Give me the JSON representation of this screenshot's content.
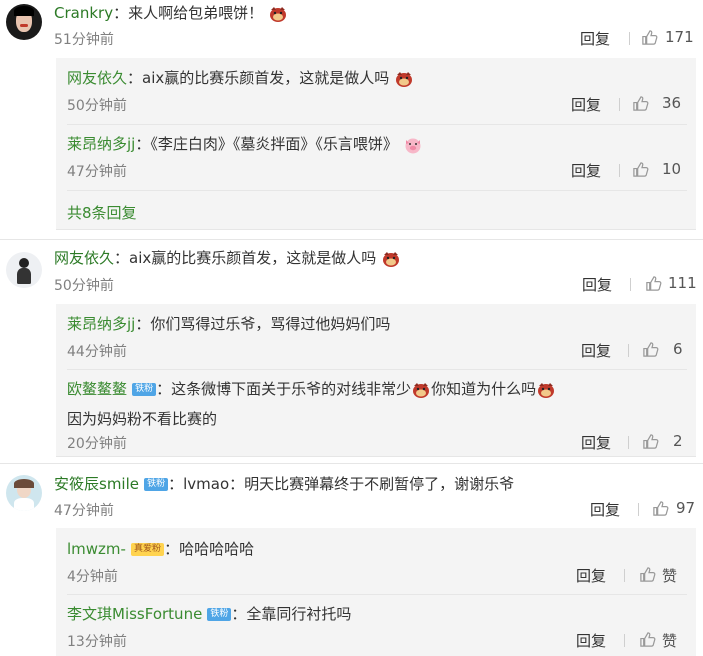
{
  "thumb_color": "#999999",
  "comments": [
    {
      "user": "Crankry",
      "text": "：来人啊给包弟喂饼！",
      "time": "51分钟前",
      "reply": "回复",
      "likes": "171",
      "subs": [
        {
          "user": "网友依久",
          "text": "：aix赢的比赛乐颜首发，这就是做人吗",
          "time": "50分钟前",
          "reply": "回复",
          "likes": "36"
        },
        {
          "user": "莱昂纳多jj",
          "text": "：《李庄白肉》《墓炎拌面》《乐言喂饼》",
          "time": "47分钟前",
          "reply": "回复",
          "likes": "10"
        }
      ],
      "more": "共8条回复"
    },
    {
      "user": "网友依久",
      "text": "：aix赢的比赛乐颜首发，这就是做人吗",
      "time": "50分钟前",
      "reply": "回复",
      "likes": "111",
      "subs": [
        {
          "user": "莱昂纳多jj",
          "text": "：你们骂得过乐爷，骂得过他妈妈们吗",
          "time": "44分钟前",
          "reply": "回复",
          "likes": "6"
        },
        {
          "user": "欧鳌鳌鳌",
          "badge": "铁粉",
          "text": "：这条微博下面关于乐爷的对线非常少",
          "text_b": "你知道为什么吗",
          "text2": "因为妈妈粉不看比赛的",
          "time": "20分钟前",
          "reply": "回复",
          "likes": "2"
        }
      ]
    },
    {
      "user": "安筱辰smile",
      "badge": "铁粉",
      "text": "：lvmao：明天比赛弹幕终于不刷暂停了，谢谢乐爷",
      "time": "47分钟前",
      "reply": "回复",
      "likes": "97",
      "subs": [
        {
          "user": "lmwzm-",
          "badge": "真爱粉",
          "text": "：哈哈哈哈哈",
          "time": "4分钟前",
          "reply": "回复",
          "likes": "赞"
        },
        {
          "user": "李文琪MissFortune",
          "badge": "铁粉",
          "text": "：全靠同行衬托吗",
          "time": "13分钟前",
          "reply": "回复",
          "likes": "赞"
        }
      ]
    }
  ]
}
